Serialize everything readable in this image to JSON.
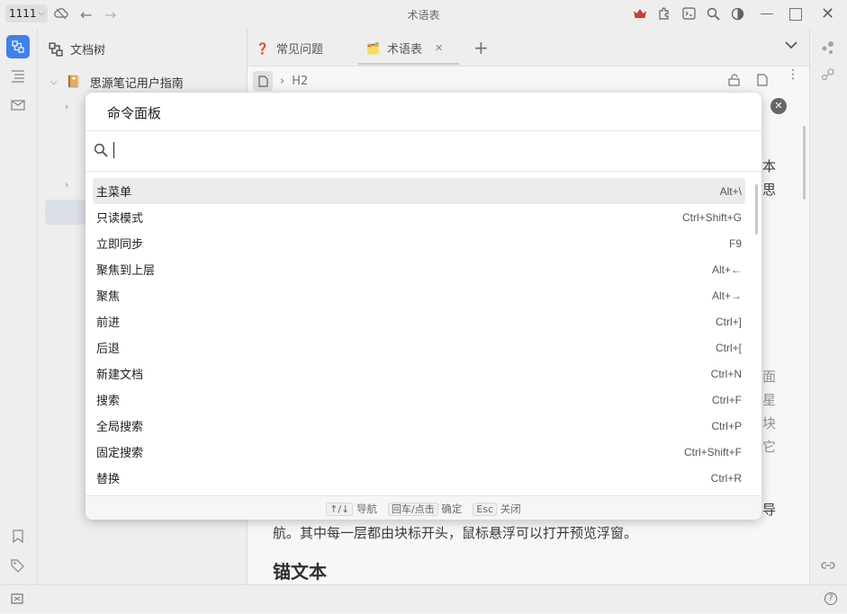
{
  "titlebar": {
    "workspace": "1111",
    "title": "术语表"
  },
  "filetree": {
    "header": "文档树",
    "notebook": "思源笔记用户指南"
  },
  "tabs": [
    {
      "icon": "❓",
      "label": "常见问题"
    },
    {
      "icon": "🗂️",
      "label": "术语表"
    }
  ],
  "editor": {
    "breadcrumb": "H2",
    "right_text_lines": [
      "本",
      "思",
      "面",
      "星",
      "块",
      "它",
      "导"
    ],
    "bottom_line": "航。其中每一层都由块标开头，鼠标悬浮可以打开预览浮窗。",
    "heading": "锚文本"
  },
  "command_panel": {
    "title": "命令面板",
    "search_value": "",
    "commands": [
      {
        "label": "主菜单",
        "key": "Alt+\\"
      },
      {
        "label": "只读模式",
        "key": "Ctrl+Shift+G"
      },
      {
        "label": "立即同步",
        "key": "F9"
      },
      {
        "label": "聚焦到上层",
        "key": "Alt+←"
      },
      {
        "label": "聚焦",
        "key": "Alt+→"
      },
      {
        "label": "前进",
        "key": "Ctrl+]"
      },
      {
        "label": "后退",
        "key": "Ctrl+["
      },
      {
        "label": "新建文档",
        "key": "Ctrl+N"
      },
      {
        "label": "搜索",
        "key": "Ctrl+F"
      },
      {
        "label": "全局搜索",
        "key": "Ctrl+P"
      },
      {
        "label": "固定搜索",
        "key": "Ctrl+Shift+F"
      },
      {
        "label": "替换",
        "key": "Ctrl+R"
      }
    ],
    "footer": {
      "nav_key": "↑/↓",
      "nav_label": "导航",
      "confirm_key": "回车/点击",
      "confirm_label": "确定",
      "close_key": "Esc",
      "close_label": "关闭"
    }
  },
  "colors": {
    "accent": "#4285f4",
    "crown": "#d23f31"
  }
}
